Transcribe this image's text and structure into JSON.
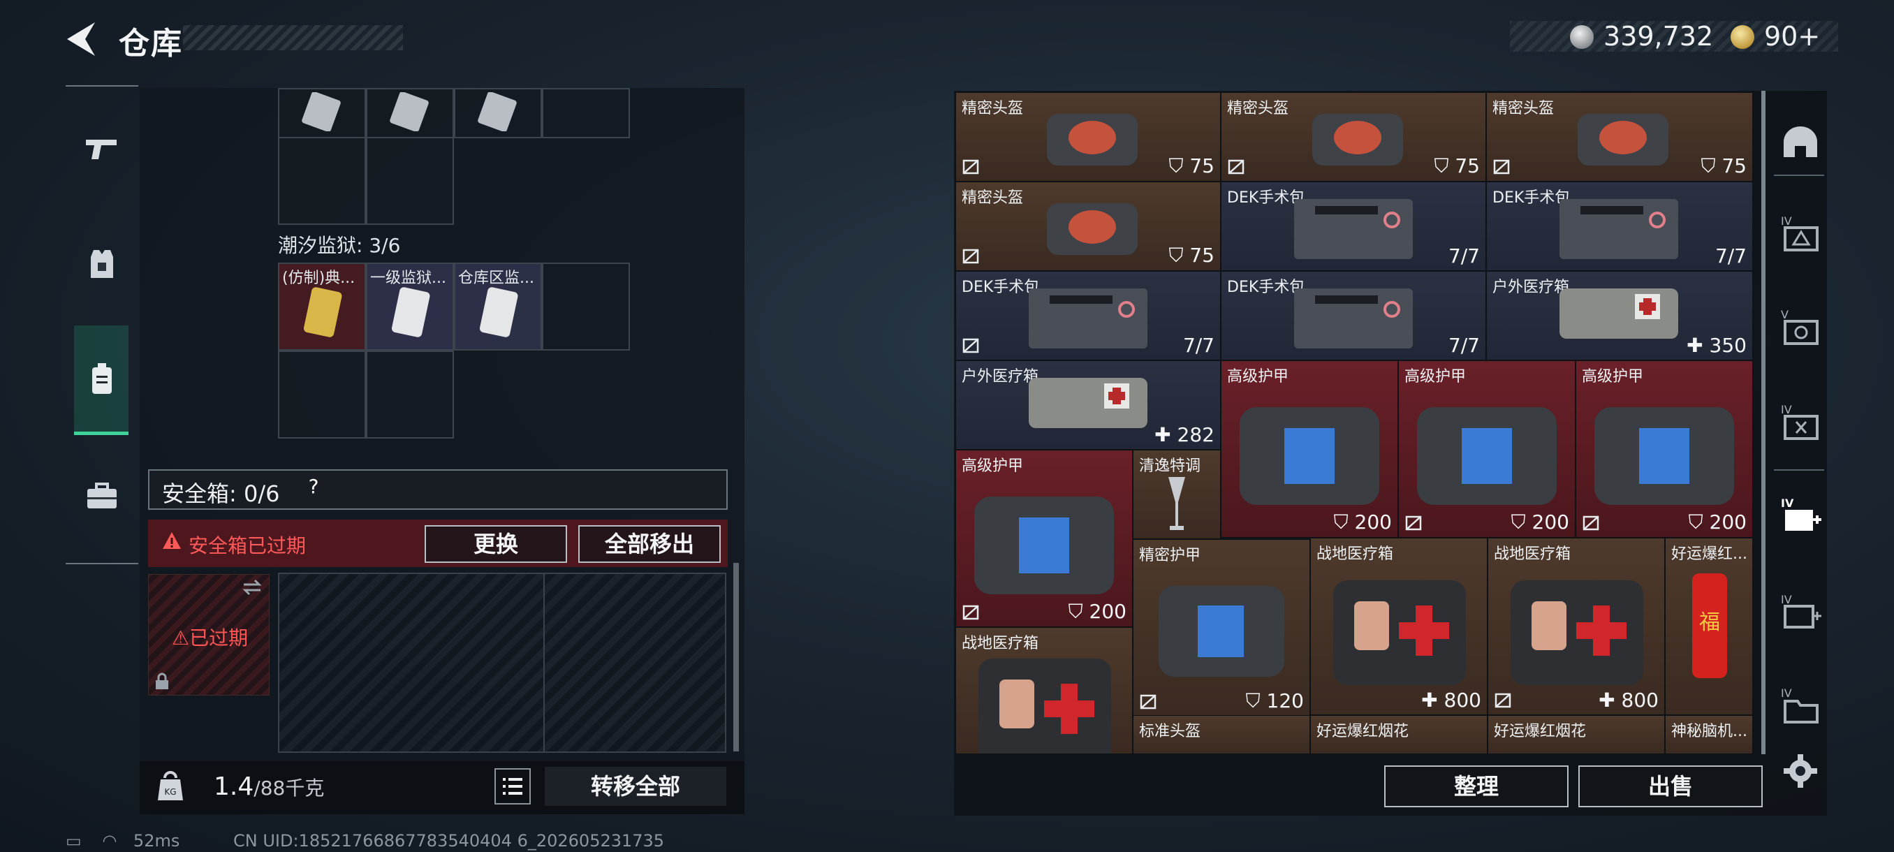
{
  "header": {
    "title": "仓库",
    "silver": "339,732",
    "gold": "90+"
  },
  "left": {
    "prison_label": "潮汐监狱: 3/6",
    "prison_items": [
      "(仿制)典...",
      "一级监狱...",
      "仓库区监..."
    ],
    "safe_label": "安全箱: 0/6",
    "safe_help": "?",
    "expired_warning": "安全箱已过期",
    "replace_label": "更换",
    "move_all_label": "全部移出",
    "case_expired": "已过期",
    "weight": "1.4",
    "weight_unit": "/88千克",
    "transfer_label": "转移全部"
  },
  "status": {
    "ping": "52ms",
    "uid": "CN UID:18521766867783540404 6_202605231735"
  },
  "right": {
    "items": [
      {
        "name": "精密头盔",
        "value": "75",
        "icon": "shield",
        "flag": true
      },
      {
        "name": "精密头盔",
        "value": "75",
        "icon": "shield",
        "flag": true
      },
      {
        "name": "精密头盔",
        "value": "75",
        "icon": "shield",
        "flag": true
      },
      {
        "name": "精密头盔",
        "value": "75",
        "icon": "shield",
        "flag": true
      },
      {
        "name": "DEK手术包",
        "value": "7/7",
        "icon": "",
        "flag": false
      },
      {
        "name": "DEK手术包",
        "value": "7/7",
        "icon": "",
        "flag": false
      },
      {
        "name": "DEK手术包",
        "value": "7/7",
        "icon": "",
        "flag": true
      },
      {
        "name": "DEK手术包",
        "value": "7/7",
        "icon": "",
        "flag": false
      },
      {
        "name": "户外医疗箱",
        "value": "350",
        "icon": "plus",
        "flag": false
      },
      {
        "name": "户外医疗箱",
        "value": "282",
        "icon": "plus",
        "flag": false
      },
      {
        "name": "高级护甲",
        "value": "200",
        "icon": "shield",
        "flag": false
      },
      {
        "name": "高级护甲",
        "value": "200",
        "icon": "shield",
        "flag": true
      },
      {
        "name": "高级护甲",
        "value": "200",
        "icon": "shield",
        "flag": true
      },
      {
        "name": "高级护甲",
        "value": "200",
        "icon": "shield",
        "flag": true
      },
      {
        "name": "清逸特调",
        "value": "",
        "icon": "",
        "flag": false
      },
      {
        "name": "精密护甲",
        "value": "120",
        "icon": "shield",
        "flag": true
      },
      {
        "name": "战地医疗箱",
        "value": "800",
        "icon": "plus",
        "flag": false
      },
      {
        "name": "战地医疗箱",
        "value": "800",
        "icon": "plus",
        "flag": true
      },
      {
        "name": "好运爆红...",
        "value": "",
        "icon": "",
        "flag": false
      },
      {
        "name": "战地医疗箱",
        "value": "",
        "icon": "",
        "flag": false
      },
      {
        "name": "标准头盔",
        "value": "",
        "icon": "",
        "flag": false
      },
      {
        "name": "好运爆红烟花",
        "value": "",
        "icon": "",
        "flag": false
      },
      {
        "name": "好运爆红烟花",
        "value": "",
        "icon": "",
        "flag": false
      },
      {
        "name": "神秘脑机...",
        "value": "",
        "icon": "",
        "flag": false
      }
    ],
    "sort_label": "整理",
    "sell_label": "出售"
  },
  "colors": {
    "accent_green": "#3fd39a",
    "danger_red": "#ff5a5a"
  }
}
